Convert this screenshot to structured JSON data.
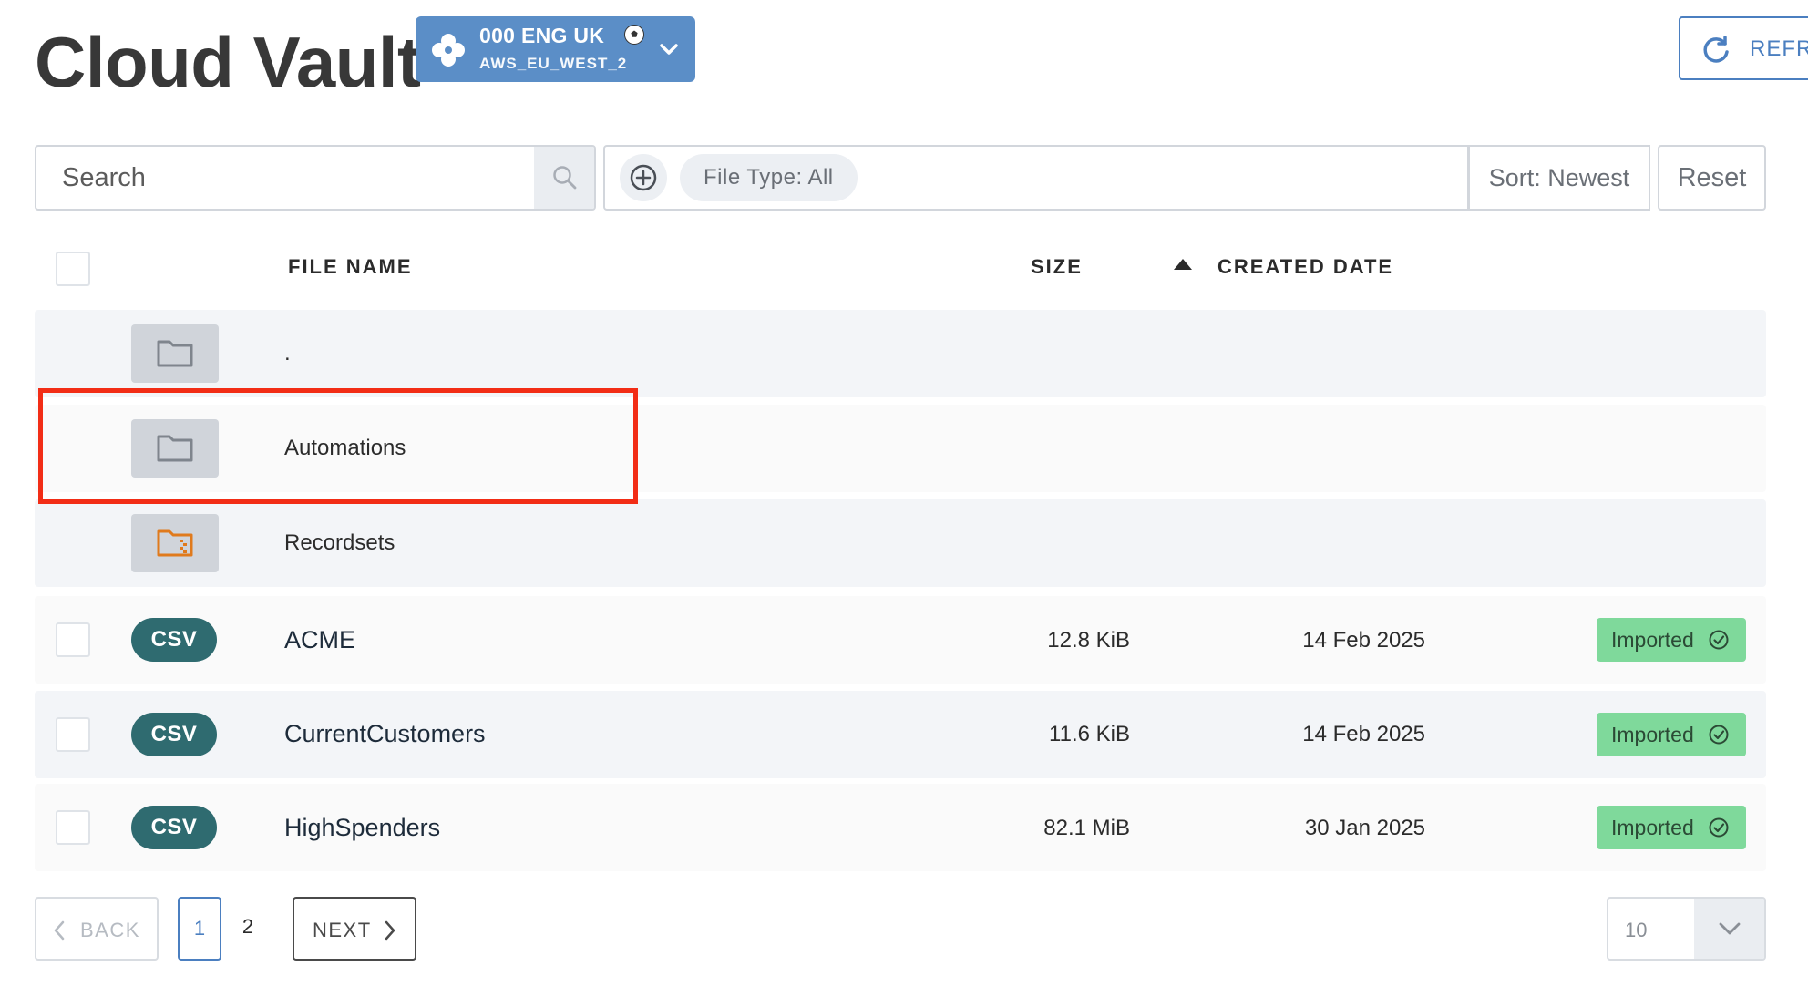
{
  "header": {
    "title": "Cloud Vault",
    "workspace": {
      "name": "000 ENG UK",
      "region": "AWS_EU_WEST_2"
    },
    "refresh_label": "REFRI"
  },
  "filters": {
    "search_placeholder": "Search",
    "file_type_chip": "File Type: All",
    "sort_label": "Sort: Newest",
    "reset_label": "Reset"
  },
  "table": {
    "columns": {
      "file_name": "FILE NAME",
      "size": "SIZE",
      "created_date": "CREATED DATE"
    },
    "folders": [
      {
        "name": "."
      },
      {
        "name": "Automations"
      },
      {
        "name": "Recordsets"
      }
    ],
    "files": [
      {
        "type": "CSV",
        "name": "ACME",
        "size": "12.8 KiB",
        "date": "14 Feb 2025",
        "status": "Imported"
      },
      {
        "type": "CSV",
        "name": "CurrentCustomers",
        "size": "11.6 KiB",
        "date": "14 Feb 2025",
        "status": "Imported"
      },
      {
        "type": "CSV",
        "name": "HighSpenders",
        "size": "82.1 MiB",
        "date": "30 Jan 2025",
        "status": "Imported"
      }
    ]
  },
  "pagination": {
    "back_label": "BACK",
    "pages": [
      "1",
      "2"
    ],
    "next_label": "NEXT",
    "per_page": "10"
  },
  "colors": {
    "accent": "#4b7fc0",
    "workspace_bg": "#5b8ec7",
    "csv_badge": "#2f6b70",
    "imported_badge": "#7fd99b",
    "highlight": "#f22d16",
    "recordset_icon": "#e07a1c"
  }
}
